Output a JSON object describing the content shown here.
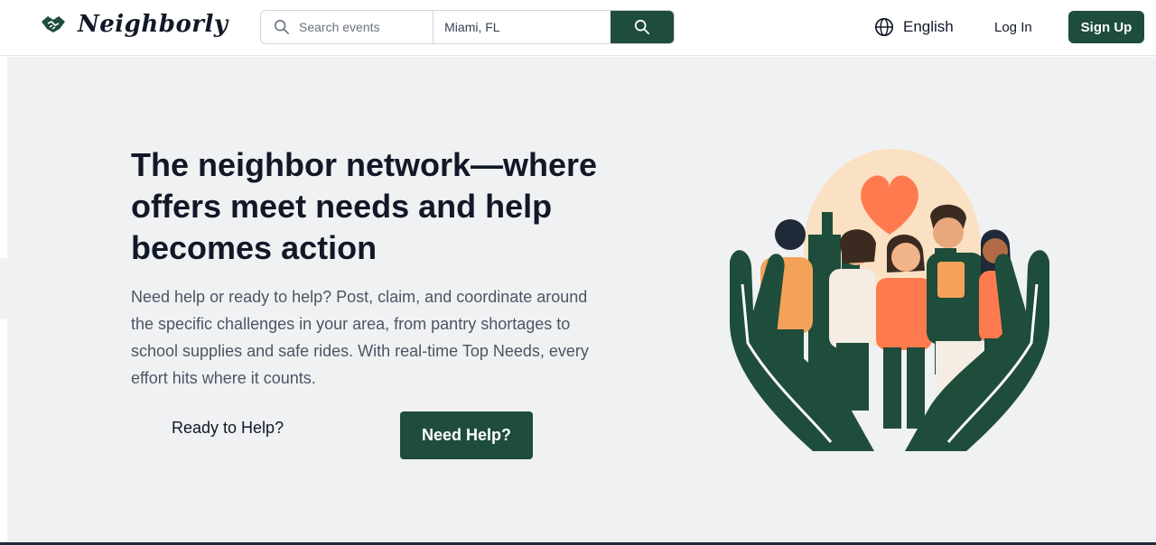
{
  "brand": {
    "name": "Neighborly"
  },
  "search": {
    "events_placeholder": "Search events",
    "location_value": "Miami, FL"
  },
  "nav": {
    "language": "English",
    "login": "Log In",
    "signup": "Sign Up"
  },
  "hero": {
    "title": "The neighbor network—where offers meet needs and help becomes action",
    "description": "Need help or ready to help? Post, claim, and coordinate around the specific challenges in your area, from pantry shortages to school supplies and safe rides. With real-time Top Needs, every effort hits where it counts.",
    "ready_button": "Ready to Help?",
    "need_button": "Need Help?"
  },
  "icons": [
    "handshake-icon",
    "search-icon",
    "globe-icon"
  ],
  "colors": {
    "brand_green": "#1e4d3b",
    "hero_bg": "#f0f1f3",
    "heart": "#ff7b4f"
  }
}
